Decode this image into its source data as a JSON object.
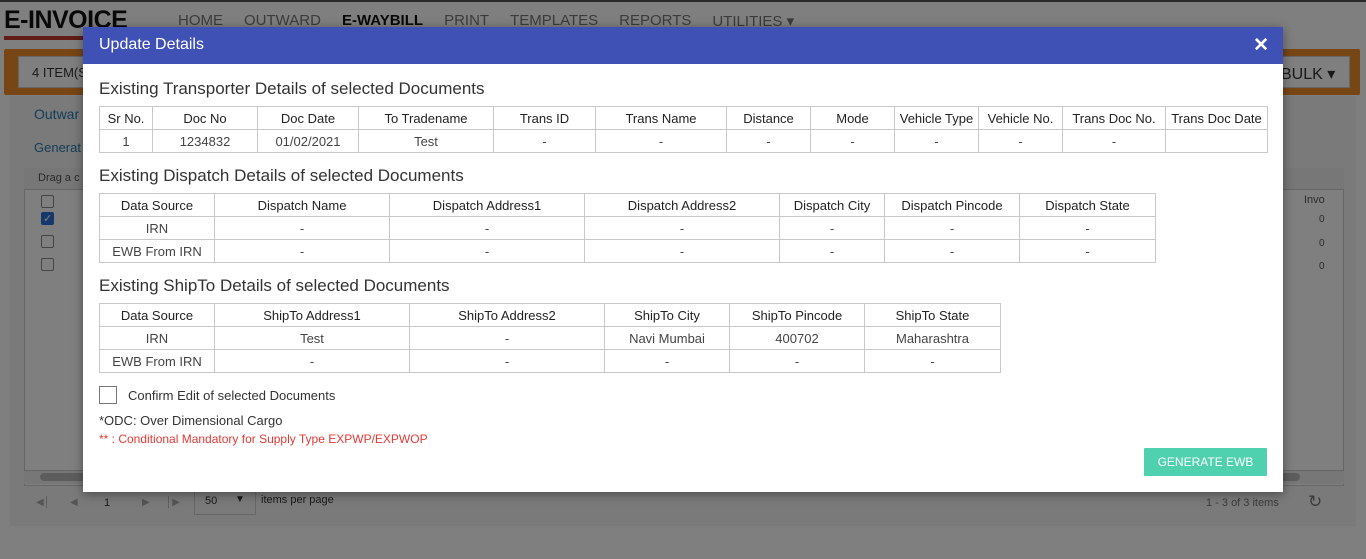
{
  "app": {
    "brand": "E-INVOICE",
    "menu": [
      "HOME",
      "OUTWARD",
      "E-WAYBILL",
      "PRINT",
      "TEMPLATES",
      "REPORTS",
      "UTILITIES ▾"
    ],
    "items_label": "4 ITEM(S",
    "bulk_label": "BULK ▾",
    "tab_outward": "Outwar",
    "tab_generate": "Generat",
    "grid_hint": "Drag a c",
    "invo_label": "Invo",
    "zero_values": [
      "0",
      "0",
      "0"
    ],
    "pager": {
      "page": "1",
      "page_size": "50",
      "items_per_page": "items per page",
      "count": "1 - 3 of 3 items"
    }
  },
  "modal": {
    "title": "Update Details",
    "transporter": {
      "title": "Existing Transporter Details of selected Documents",
      "headers": [
        "Sr No.",
        "Doc No",
        "Doc Date",
        "To Tradename",
        "Trans ID",
        "Trans Name",
        "Distance",
        "Mode",
        "Vehicle Type",
        "Vehicle No.",
        "Trans Doc No.",
        "Trans Doc Date"
      ],
      "rows": [
        [
          "1",
          "1234832",
          "01/02/2021",
          "Test",
          "-",
          "-",
          "-",
          "-",
          "-",
          "-",
          "-",
          ""
        ]
      ]
    },
    "dispatch": {
      "title": "Existing Dispatch Details of selected Documents",
      "headers": [
        "Data Source",
        "Dispatch Name",
        "Dispatch Address1",
        "Dispatch Address2",
        "Dispatch City",
        "Dispatch Pincode",
        "Dispatch State"
      ],
      "rows": [
        [
          "IRN",
          "-",
          "-",
          "-",
          "-",
          "-",
          "-"
        ],
        [
          "EWB From IRN",
          "-",
          "-",
          "-",
          "-",
          "-",
          "-"
        ]
      ]
    },
    "shipto": {
      "title": "Existing ShipTo Details of selected Documents",
      "headers": [
        "Data Source",
        "ShipTo Address1",
        "ShipTo Address2",
        "ShipTo City",
        "ShipTo Pincode",
        "ShipTo State"
      ],
      "rows": [
        [
          "IRN",
          "Test",
          "-",
          "Navi Mumbai",
          "400702",
          "Maharashtra"
        ],
        [
          "EWB From IRN",
          "-",
          "-",
          "-",
          "-",
          "-"
        ]
      ]
    },
    "confirm_label": "Confirm Edit of selected Documents",
    "odc_note": "*ODC: Over Dimensional Cargo",
    "red_note": "** : Conditional Mandatory for Supply Type EXPWP/EXPWOP",
    "generate_button": "GENERATE EWB"
  },
  "colors": {
    "modal_header": "#3f51b5",
    "generate_button": "#4fd1b0",
    "orange_bar": "#f08c2a",
    "red_note": "#e53935"
  }
}
